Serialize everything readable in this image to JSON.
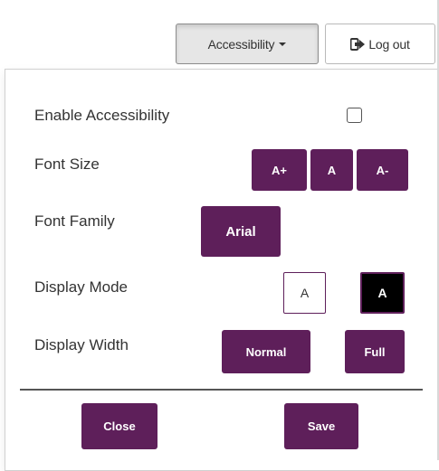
{
  "topbar": {
    "accessibility_label": "Accessibility",
    "logout_label": "Log out"
  },
  "panel": {
    "enable": {
      "label": "Enable Accessibility",
      "checked": false
    },
    "font_size": {
      "label": "Font Size",
      "options": [
        "A+",
        "A",
        "A-"
      ]
    },
    "font_family": {
      "label": "Font Family",
      "option": "Arial"
    },
    "display_mode": {
      "label": "Display Mode",
      "light": "A",
      "dark": "A"
    },
    "display_width": {
      "label": "Display Width",
      "normal": "Normal",
      "full": "Full"
    },
    "close_label": "Close",
    "save_label": "Save"
  },
  "colors": {
    "accent": "#5e1f5a",
    "dark_mode_bg": "#000000"
  },
  "icons": {
    "logout": "sign-out-icon",
    "dropdown": "caret-down-icon"
  }
}
